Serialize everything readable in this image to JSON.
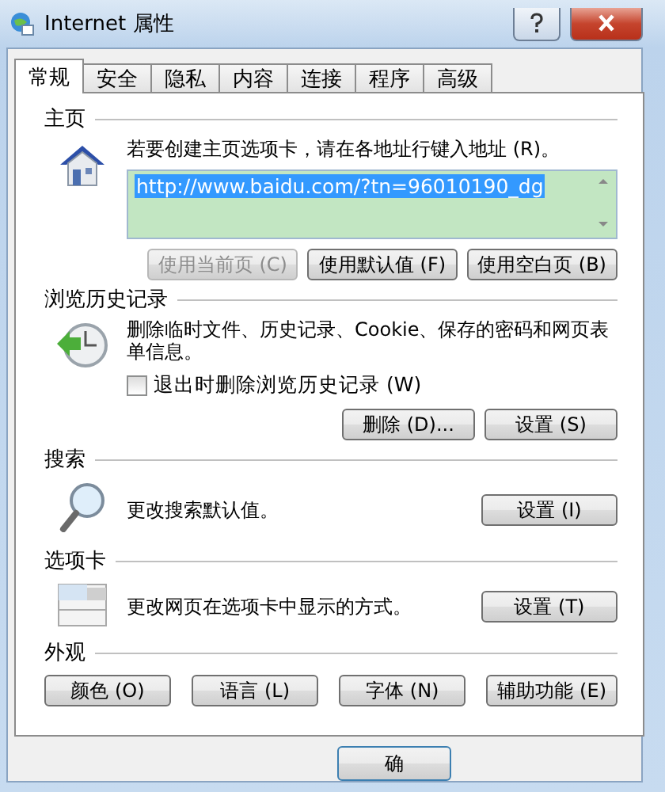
{
  "window": {
    "title": "Internet 属性"
  },
  "tabs": [
    {
      "label": "常规",
      "selected": true
    },
    {
      "label": "安全",
      "selected": false
    },
    {
      "label": "隐私",
      "selected": false
    },
    {
      "label": "内容",
      "selected": false
    },
    {
      "label": "连接",
      "selected": false
    },
    {
      "label": "程序",
      "selected": false
    },
    {
      "label": "高级",
      "selected": false
    }
  ],
  "sections": [
    {
      "kind": "home",
      "title": "主页",
      "text": "若要创建主页选项卡，请在各地址行键入地址 (R)。",
      "url": "http://www.baidu.com/?tn=96010190_dg",
      "buttons": [
        {
          "label": "使用当前页 (C)",
          "disabled": true
        },
        {
          "label": "使用默认值 (F)",
          "disabled": false
        },
        {
          "label": "使用空白页 (B)",
          "disabled": false
        }
      ]
    },
    {
      "kind": "history",
      "title": "浏览历史记录",
      "text": "删除临时文件、历史记录、Cookie、保存的密码和网页表单信息。",
      "checkbox": {
        "label": "退出时删除浏览历史记录 (W)",
        "checked": false
      },
      "buttons": [
        {
          "label": "删除 (D)...",
          "disabled": false
        },
        {
          "label": "设置 (S)",
          "disabled": false
        }
      ]
    },
    {
      "kind": "search",
      "title": "搜索",
      "text": "更改搜索默认值。",
      "buttons": [
        {
          "label": "设置 (I)",
          "disabled": false
        }
      ]
    },
    {
      "kind": "tabs",
      "title": "选项卡",
      "text": "更改网页在选项卡中显示的方式。",
      "buttons": [
        {
          "label": "设置 (T)",
          "disabled": false
        }
      ]
    },
    {
      "kind": "appearance",
      "title": "外观",
      "buttons": [
        {
          "label": "颜色 (O)",
          "disabled": false
        },
        {
          "label": "语言 (L)",
          "disabled": false
        },
        {
          "label": "字体 (N)",
          "disabled": false
        },
        {
          "label": "辅助功能 (E)",
          "disabled": false
        }
      ]
    }
  ],
  "footer_buttons": [
    "确"
  ]
}
